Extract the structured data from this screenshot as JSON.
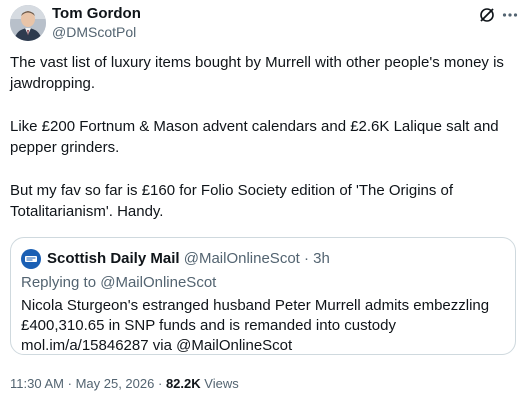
{
  "author": {
    "name": "Tom Gordon",
    "handle": "@DMScotPol",
    "avatar_icon": "person-photo-avatar"
  },
  "actions": {
    "grok_icon": "grok-slash-icon",
    "more_icon": "more-dots-icon"
  },
  "tweet": {
    "paragraphs": [
      "The vast list of luxury items bought by Murrell with other people's money is jawdropping.",
      "Like £200 Fortnum & Mason advent calendars and £2.6K Lalique salt and pepper grinders.",
      "But my fav so far is £160 for Folio Society edition of 'The Origins of Totalitarianism'. Handy."
    ]
  },
  "quote": {
    "source_name": "Scottish Daily Mail",
    "source_handle": "@MailOnlineScot",
    "separator": "·",
    "time": "3h",
    "replying_prefix": "Replying to",
    "replying_to": "@MailOnlineScot",
    "body": "Nicola Sturgeon's estranged husband Peter Murrell admits embezzling £400,310.65 in SNP funds and is remanded into custody mol.im/a/15846287 via @MailOnlineScot",
    "logo_icon": "daily-mail-logo",
    "logo_color": "#1a5fb4"
  },
  "meta": {
    "time": "11:30 AM",
    "separator": "·",
    "date": "May 25, 2026",
    "views_count": "82.2K",
    "views_label": "Views"
  },
  "colors": {
    "text_primary": "#0f1419",
    "text_secondary": "#536471",
    "border": "#cfd9de"
  }
}
